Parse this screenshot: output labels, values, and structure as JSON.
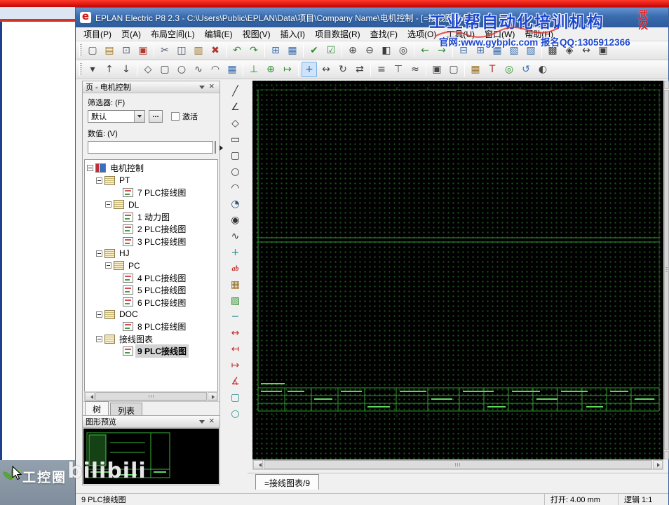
{
  "window": {
    "title": "EPLAN Electric P8 2.3 - C:\\Users\\Public\\EPLAN\\Data\\项目\\Company Name\\电机控制 - [=接线图表/9]"
  },
  "watermark": {
    "line1": "工业帮自动化培训机构",
    "seal": "武汉",
    "line2": "官网:www.gybplc.com   报名QQ:1305912366"
  },
  "background_window": {
    "brand": "工控圈",
    "bilibili": "bilibili"
  },
  "menu": {
    "items": [
      "项目(P)",
      "页(A)",
      "布局空间(L)",
      "编辑(E)",
      "视图(V)",
      "插入(I)",
      "项目数据(R)",
      "查找(F)",
      "选项(O)",
      "工具(U)",
      "窗口(W)",
      "帮助(H)"
    ]
  },
  "toolbar1": {
    "items": [
      {
        "n": "new-page",
        "g": "▢",
        "c": "#555"
      },
      {
        "n": "open-project",
        "g": "▤",
        "c": "#a97b22"
      },
      {
        "n": "print",
        "g": "⊡",
        "c": "#51607a"
      },
      {
        "n": "pdf-export",
        "g": "▣",
        "c": "#b03a30"
      },
      {
        "sep": true
      },
      {
        "n": "cut",
        "g": "✂",
        "c": "#4a5568"
      },
      {
        "n": "copy",
        "g": "◫",
        "c": "#4a5568"
      },
      {
        "n": "paste",
        "g": "▥",
        "c": "#9a7224"
      },
      {
        "n": "delete",
        "g": "✖",
        "c": "#b3342e"
      },
      {
        "sep": true
      },
      {
        "n": "undo",
        "g": "↶",
        "c": "#2f8f2f"
      },
      {
        "n": "redo",
        "g": "↷",
        "c": "#2f8f2f"
      },
      {
        "sep": true
      },
      {
        "n": "goto-graphic",
        "g": "⊞",
        "c": "#3a6fae"
      },
      {
        "n": "page-navigator",
        "g": "▦",
        "c": "#3a6fae"
      },
      {
        "sep": true
      },
      {
        "n": "verify",
        "g": "✔",
        "c": "#2f8f2f"
      },
      {
        "n": "project-check",
        "g": "☑",
        "c": "#2f8f2f"
      },
      {
        "sep": true
      },
      {
        "n": "zoom-in",
        "g": "⊕",
        "c": "#3c3c3c"
      },
      {
        "n": "zoom-out",
        "g": "⊖",
        "c": "#3c3c3c"
      },
      {
        "n": "zoom-window",
        "g": "◧",
        "c": "#3c3c3c"
      },
      {
        "n": "zoom-fit",
        "g": "◎",
        "c": "#3c3c3c"
      },
      {
        "sep": true
      },
      {
        "n": "prev-page",
        "g": "←",
        "c": "#2f8f2f"
      },
      {
        "n": "next-page",
        "g": "→",
        "c": "#2f8f2f"
      },
      {
        "sep": true
      },
      {
        "n": "terminal-diagram",
        "g": "⊟",
        "c": "#3a6fae"
      },
      {
        "n": "device-list",
        "g": "⊞",
        "c": "#3a6fae"
      },
      {
        "n": "cable-overview",
        "g": "▦",
        "c": "#3a6fae"
      },
      {
        "n": "report",
        "g": "▧",
        "c": "#3a6fae"
      },
      {
        "n": "label",
        "g": "▨",
        "c": "#3a6fae"
      },
      {
        "sep": true
      },
      {
        "n": "grid-display",
        "g": "▩",
        "c": "#3c3c3c"
      },
      {
        "n": "snap",
        "g": "◈",
        "c": "#3c3c3c"
      },
      {
        "n": "ruler",
        "g": "↔",
        "c": "#3c3c3c"
      },
      {
        "n": "lock",
        "g": "▣",
        "c": "#3c3c3c"
      }
    ]
  },
  "toolbar2": {
    "items": [
      {
        "n": "page-dropdown",
        "g": "▾",
        "c": "#3c3c3c"
      },
      {
        "n": "page-up",
        "g": "↑",
        "c": "#3c3c3c"
      },
      {
        "n": "page-down",
        "g": "↓",
        "c": "#3c3c3c"
      },
      {
        "sep": true
      },
      {
        "n": "symbol",
        "g": "◇",
        "c": "#444444"
      },
      {
        "n": "device",
        "g": "▢",
        "c": "#444444"
      },
      {
        "n": "terminal",
        "g": "○",
        "c": "#444444"
      },
      {
        "n": "cable",
        "g": "∿",
        "c": "#444444"
      },
      {
        "n": "shield",
        "g": "◠",
        "c": "#444444"
      },
      {
        "n": "plc-box",
        "g": "▦",
        "c": "#3a6fae"
      },
      {
        "sep": true
      },
      {
        "n": "connection",
        "g": "⊥",
        "c": "#2f8f2f"
      },
      {
        "n": "junction",
        "g": "⊕",
        "c": "#2f8f2f"
      },
      {
        "n": "reference",
        "g": "↦",
        "c": "#2f8f2f"
      },
      {
        "sep": true
      },
      {
        "n": "select-tool",
        "g": "+",
        "c": "#2c62b8",
        "active": true
      },
      {
        "n": "move",
        "g": "↔",
        "c": "#444444"
      },
      {
        "n": "rotate",
        "g": "↻",
        "c": "#444444"
      },
      {
        "n": "mirror",
        "g": "⇄",
        "c": "#444444"
      },
      {
        "sep": true
      },
      {
        "n": "align-left",
        "g": "≡",
        "c": "#444444"
      },
      {
        "n": "align-top",
        "g": "⊤",
        "c": "#444444"
      },
      {
        "n": "distribute",
        "g": "≈",
        "c": "#444444"
      },
      {
        "sep": true
      },
      {
        "n": "group",
        "g": "▣",
        "c": "#444444"
      },
      {
        "n": "ungroup",
        "g": "▢",
        "c": "#444444"
      },
      {
        "sep": true
      },
      {
        "n": "insert-image",
        "g": "▦",
        "c": "#9a7224"
      },
      {
        "n": "insert-text",
        "g": "T",
        "c": "#b3342e"
      },
      {
        "n": "measure",
        "g": "◎",
        "c": "#2f8f2f"
      },
      {
        "n": "update",
        "g": "↺",
        "c": "#3a6fae"
      },
      {
        "n": "options-tool",
        "g": "◐",
        "c": "#444444"
      }
    ]
  },
  "vtoolbar": {
    "items": [
      {
        "n": "line",
        "g": "╱",
        "c": "#333333"
      },
      {
        "n": "polyline",
        "g": "∠",
        "c": "#333333"
      },
      {
        "n": "polygon",
        "g": "◇",
        "c": "#333333"
      },
      {
        "n": "rectangle",
        "g": "▭",
        "c": "#333333"
      },
      {
        "n": "rectangle-2",
        "g": "▢",
        "c": "#333333"
      },
      {
        "n": "circle",
        "g": "○",
        "c": "#333333"
      },
      {
        "n": "arc",
        "g": "◠",
        "c": "#333333"
      },
      {
        "n": "sector",
        "g": "◔",
        "c": "#335577"
      },
      {
        "n": "ellipse",
        "g": "◉",
        "c": "#333333"
      },
      {
        "n": "spline",
        "g": "∿",
        "c": "#333333"
      },
      {
        "n": "crosshair",
        "g": "+",
        "c": "#2a8f8f"
      },
      {
        "n": "text",
        "g": "ab",
        "c": "#c03030",
        "text": true
      },
      {
        "n": "image",
        "g": "▦",
        "c": "#9a7224"
      },
      {
        "n": "hatch-fill",
        "g": "▨",
        "c": "#2f8f2f"
      },
      {
        "n": "line-style",
        "g": "─",
        "c": "#2a8f8f"
      },
      {
        "n": "dimension-linear",
        "g": "↔",
        "c": "#c03030"
      },
      {
        "n": "dimension-continued",
        "g": "↤",
        "c": "#c03030"
      },
      {
        "n": "dimension-baseline",
        "g": "↦",
        "c": "#c03030"
      },
      {
        "n": "dimension-angle",
        "g": "∡",
        "c": "#c03030"
      },
      {
        "n": "style-box",
        "g": "▢",
        "c": "#2a8f8f"
      },
      {
        "n": "style-circle",
        "g": "○",
        "c": "#2a8f8f"
      }
    ]
  },
  "pages_panel": {
    "title": "页 - 电机控制",
    "filter_label": "筛选器: (F)",
    "filter_value": "默认",
    "browse_button": "...",
    "active_checkbox": "激活",
    "value_label": "数值: (V)",
    "value_input": "",
    "tabs": [
      {
        "label": "树",
        "active": true
      },
      {
        "label": "列表",
        "active": false
      }
    ],
    "tree": [
      {
        "label": "电机控制",
        "indent": 0,
        "icon": "project",
        "exp": true
      },
      {
        "label": "PT",
        "indent": 1,
        "icon": "folder",
        "exp": true
      },
      {
        "label": "7 PLC接线图",
        "indent": 3,
        "icon": "page"
      },
      {
        "label": "DL",
        "indent": 2,
        "icon": "folder",
        "exp": true
      },
      {
        "label": "1 动力图",
        "indent": 3,
        "icon": "page"
      },
      {
        "label": "2 PLC接线图",
        "indent": 3,
        "icon": "page"
      },
      {
        "label": "3 PLC接线图",
        "indent": 3,
        "icon": "page"
      },
      {
        "label": "HJ",
        "indent": 1,
        "icon": "folder",
        "exp": true
      },
      {
        "label": "PC",
        "indent": 2,
        "icon": "folder",
        "exp": true
      },
      {
        "label": "4 PLC接线图",
        "indent": 3,
        "icon": "page"
      },
      {
        "label": "5 PLC接线图",
        "indent": 3,
        "icon": "page"
      },
      {
        "label": "6 PLC接线图",
        "indent": 3,
        "icon": "page"
      },
      {
        "label": "DOC",
        "indent": 1,
        "icon": "folder",
        "exp": true
      },
      {
        "label": "8 PLC接线图",
        "indent": 3,
        "icon": "page"
      },
      {
        "label": "接线图表",
        "indent": 1,
        "icon": "folder",
        "exp": true
      },
      {
        "label": "9 PLC接线图",
        "indent": 3,
        "icon": "page",
        "selected": true
      }
    ]
  },
  "preview_panel": {
    "title": "图形预览"
  },
  "canvas": {
    "sheet_tab": "=接线图表/9"
  },
  "statusbar": {
    "page": "9 PLC接线图",
    "grid": "打开: 4.00 mm",
    "scale": "逻辑  1:1"
  }
}
